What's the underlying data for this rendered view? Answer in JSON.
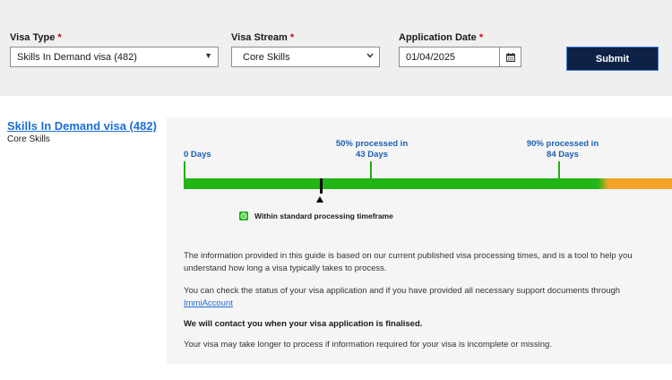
{
  "form": {
    "visa_type_label": "Visa Type",
    "visa_stream_label": "Visa Stream",
    "application_date_label": "Application Date",
    "required_mark": "*",
    "visa_type_value": "Skills In Demand visa (482)",
    "visa_stream_value": "Core Skills",
    "application_date_value": "01/04/2025",
    "submit_label": "Submit"
  },
  "result": {
    "visa_title": "Skills In Demand visa (482)",
    "visa_stream": "Core Skills"
  },
  "timeline": {
    "start_label": "0 Days",
    "p50_label_line1": "50% processed in",
    "p50_label_line2": "43 Days",
    "p90_label_line1": "90% processed in",
    "p90_label_line2": "84 Days",
    "p50_days": 43,
    "p90_days": 84,
    "status_text": "Within standard processing timeframe",
    "colors": {
      "within": "#21b515",
      "over": "#f5a328",
      "accent": "#1a5fb4"
    }
  },
  "info": {
    "para1": "The information provided in this guide is based on our current published visa processing times, and is a tool to help you understand how long a visa typically takes to process.",
    "para2_text": "You can check the status of your visa application and if you have provided all necessary support documents through",
    "para2_link": "ImmiAccount",
    "para3": "We will contact you when your visa application is finalised.",
    "para4": "Your visa may take longer to process if information required for your visa is incomplete or missing."
  }
}
